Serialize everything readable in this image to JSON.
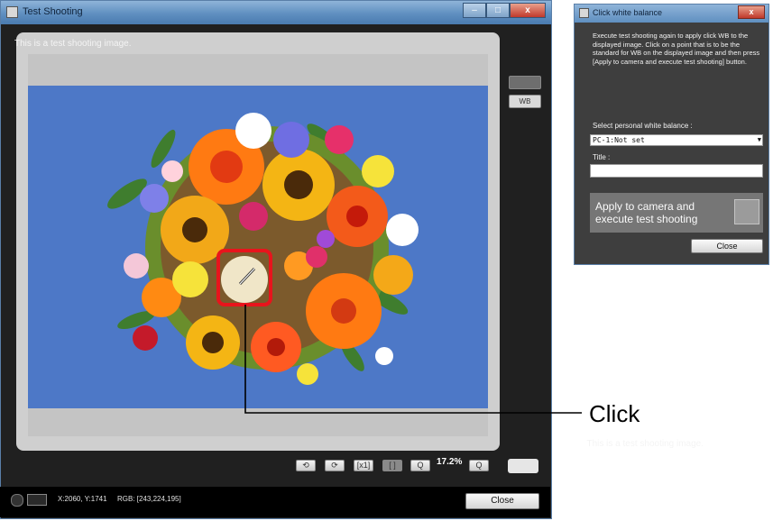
{
  "test_shooting_window": {
    "title": "Test Shooting",
    "window_controls": {
      "minimize": "–",
      "maximize": "□",
      "close": "x"
    },
    "caption_top": "This is a test shooting image.",
    "caption_bottom": "This is a test shooting image.",
    "toolbar": {
      "rotate_left": "⟲",
      "rotate_right": "⟳",
      "actual_size": "[x1]",
      "fit": "[ ]",
      "zoom_out": "Q",
      "zoom_level": "17.2%",
      "zoom_in": "Q"
    },
    "side_buttons": {
      "second": "WB"
    },
    "status": {
      "coordinates": "X:2060, Y:1741",
      "rgb": "RGB: [243,224,195]"
    },
    "close_label": "Close"
  },
  "click_wb_window": {
    "title": "Click white balance",
    "close_x": "x",
    "description": "Execute test shooting again to apply click WB to the displayed image. Click on a point that is to be the standard for WB on the displayed image and then press [Apply to camera and execute test shooting] button.",
    "select_label": "Select personal white balance :",
    "select_value": "PC-1:Not set",
    "title_label": "Title :",
    "title_value": "",
    "apply_label": "Apply to camera and execute test shooting",
    "close_label": "Close"
  },
  "callout": {
    "label": "Click"
  },
  "colors": {
    "photo_background": "#4d78c7",
    "highlight_box": "#e8141c",
    "window_frame": "#202020",
    "wb_panel": "#3e3e3e"
  }
}
